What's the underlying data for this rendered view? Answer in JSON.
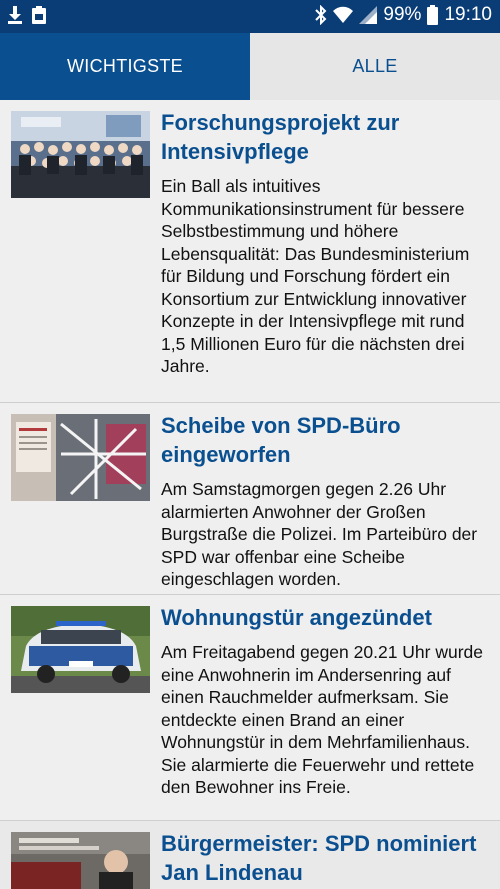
{
  "status_bar": {
    "battery": "99%",
    "time": "19:10",
    "icons": [
      "download-icon",
      "clipboard-icon",
      "bluetooth-icon",
      "wifi-icon",
      "signal-icon",
      "battery-icon"
    ]
  },
  "tabs": [
    {
      "label": "WICHTIGSTE",
      "active": true
    },
    {
      "label": "ALLE",
      "active": false
    }
  ],
  "articles": [
    {
      "title": "Forschungsprojekt zur Intensivpflege",
      "body": "Ein Ball als intuitives Kommunikationsinstrument für bessere Selbstbestimmung und höhere Lebensqualität: Das Bundesministerium für Bildung und Forschung fördert ein Konsortium zur Entwicklung innovativer Konzepte in der Intensivpflege mit rund 1,5 Millionen Euro für die nächsten drei Jahre."
    },
    {
      "title": "Scheibe von SPD-Büro eingeworfen",
      "body": "Am Samstagmorgen gegen 2.26 Uhr alarmierten Anwohner der Großen Burgstraße die Polizei. Im Parteibüro der SPD war offenbar eine Scheibe eingeschlagen worden."
    },
    {
      "title": "Wohnungstür angezündet",
      "body": "Am Freitagabend gegen 20.21 Uhr wurde eine Anwohnerin im Andersenring auf einen Rauchmelder aufmerksam. Sie entdeckte einen Brand an einer Wohnungstür in dem Mehrfamilienhaus. Sie alarmierte die Feuerwehr und rettete den Bewohner ins Freie."
    },
    {
      "title": "Bürgermeister: SPD nominiert Jan Lindenau",
      "body": ""
    }
  ],
  "colors": {
    "status_bar": "#0a3d75",
    "tab_active_bg": "#0a4f8f",
    "tab_inactive_bg": "#e6e6e6",
    "title": "#0a4f8f",
    "background": "#efefef"
  }
}
